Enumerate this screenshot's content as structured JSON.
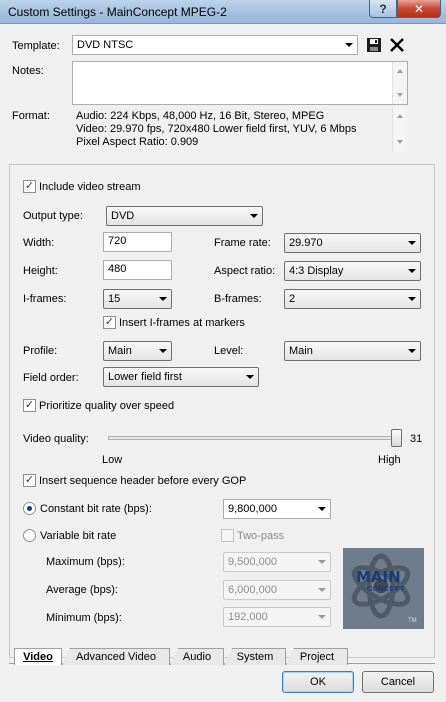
{
  "window": {
    "title": "Custom Settings - MainConcept MPEG-2",
    "help_glyph": "?",
    "close_glyph": "✕"
  },
  "template": {
    "label": "Template:",
    "value": "DVD NTSC"
  },
  "notes": {
    "label": "Notes:",
    "value": ""
  },
  "format": {
    "label": "Format:",
    "lines": [
      "Audio: 224 Kbps, 48,000 Hz, 16 Bit, Stereo, MPEG",
      "Video: 29.970 fps, 720x480 Lower field first, YUV, 6 Mbps",
      "Pixel Aspect Ratio: 0.909"
    ]
  },
  "video": {
    "include_stream_label": "Include video stream",
    "output_type_label": "Output type:",
    "output_type_value": "DVD",
    "width_label": "Width:",
    "width_value": "720",
    "height_label": "Height:",
    "height_value": "480",
    "frame_rate_label": "Frame rate:",
    "frame_rate_value": "29.970",
    "aspect_ratio_label": "Aspect ratio:",
    "aspect_ratio_value": "4:3 Display",
    "iframes_label": "I-frames:",
    "iframes_value": "15",
    "bframes_label": "B-frames:",
    "bframes_value": "2",
    "insert_iframes_label": "Insert I-frames at markers",
    "profile_label": "Profile:",
    "profile_value": "Main",
    "level_label": "Level:",
    "level_value": "Main",
    "field_order_label": "Field order:",
    "field_order_value": "Lower field first",
    "prioritize_label": "Prioritize quality over speed",
    "quality_label": "Video quality:",
    "quality_value": "31",
    "quality_fraction": 1.0,
    "quality_low": "Low",
    "quality_high": "High",
    "insert_header_label": "Insert sequence header before every GOP",
    "cbr_label": "Constant bit rate (bps):",
    "cbr_value": "9,800,000",
    "vbr_label": "Variable bit rate",
    "two_pass_label": "Two-pass",
    "maximum_label": "Maximum (bps):",
    "maximum_value": "9,500,000",
    "average_label": "Average (bps):",
    "average_value": "6,000,000",
    "minimum_label": "Minimum (bps):",
    "minimum_value": "192,000"
  },
  "logo": {
    "text_main": "MAIN",
    "text_sub": "CONCEPT",
    "tm": "TM"
  },
  "tabs": [
    "Video",
    "Advanced Video",
    "Audio",
    "System",
    "Project"
  ],
  "buttons": {
    "ok": "OK",
    "cancel": "Cancel"
  },
  "check_glyph": "✓",
  "colors": {
    "titlebar": "#a3bfe0",
    "close": "#c64a35",
    "logo_bg": "#6f7c8c"
  }
}
